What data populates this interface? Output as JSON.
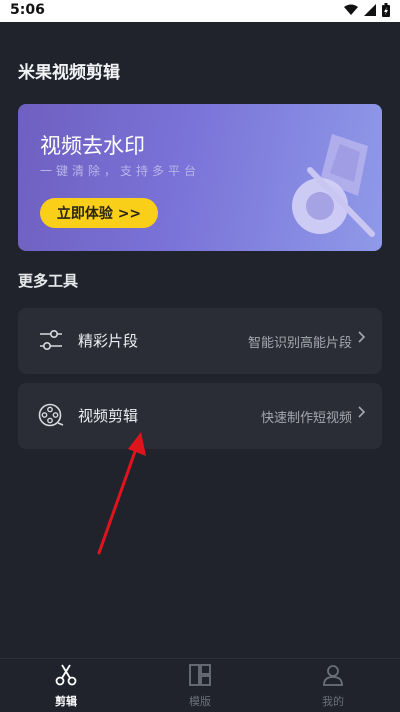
{
  "status_bar": {
    "time": "5:06"
  },
  "header": {
    "title": "米果视频剪辑"
  },
  "banner": {
    "title": "视频去水印",
    "subtitle": "一键清除，支持多平台",
    "cta_label": "立即体验 >>"
  },
  "tools_section": {
    "title": "更多工具",
    "items": [
      {
        "label": "精彩片段",
        "desc": "智能识别高能片段",
        "icon": "sliders-icon"
      },
      {
        "label": "视频剪辑",
        "desc": "快速制作短视频",
        "icon": "film-reel-icon"
      }
    ]
  },
  "bottom_nav": {
    "items": [
      {
        "label": "剪辑",
        "icon": "scissors-icon",
        "active": true
      },
      {
        "label": "模版",
        "icon": "template-grid-icon",
        "active": false
      },
      {
        "label": "我的",
        "icon": "user-icon",
        "active": false
      }
    ]
  },
  "colors": {
    "background": "#20232b",
    "card": "#2a2d35",
    "cta": "#f9cf1a",
    "annotation_arrow": "#e0141c"
  }
}
